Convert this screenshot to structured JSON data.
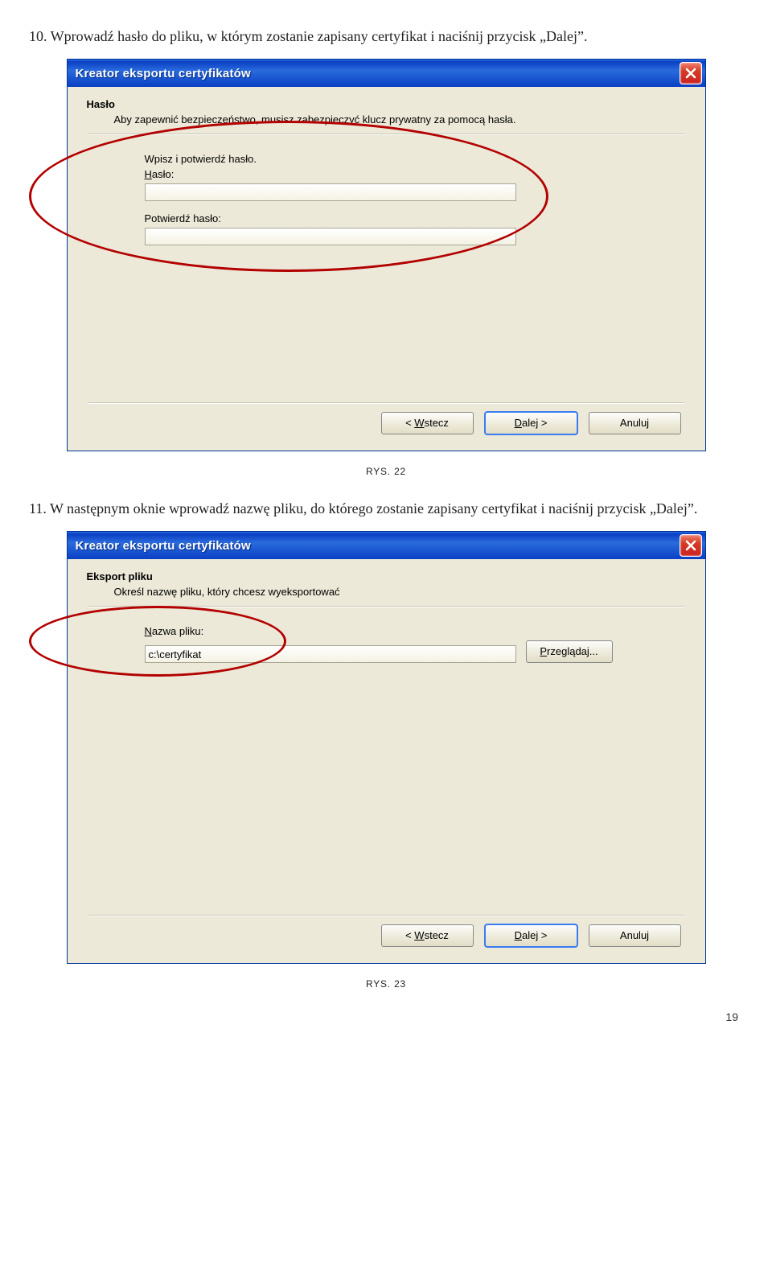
{
  "step10": {
    "text": "10. Wprowadź hasło do pliku, w którym zostanie zapisany certyfikat i naciśnij przycisk „Dalej”."
  },
  "dialog1": {
    "title": "Kreator eksportu certyfikatów",
    "heading": "Hasło",
    "desc": "Aby zapewnić bezpieczeństwo, musisz zabezpieczyć klucz prywatny za pomocą hasła.",
    "intro": "Wpisz i potwierdź hasło.",
    "password_label_pre": "H",
    "password_label_post": "asło:",
    "confirm_label": "Potwierdź hasło:",
    "back": "< Wstecz",
    "next": "Dalej >",
    "cancel": "Anuluj"
  },
  "caption1": "RYS. 22",
  "step11": {
    "text": "11. W następnym oknie wprowadź nazwę pliku, do którego zostanie zapisany certyfikat i naciśnij przycisk „Dalej”."
  },
  "dialog2": {
    "title": "Kreator eksportu certyfikatów",
    "heading": "Eksport pliku",
    "desc": "Określ nazwę pliku, który chcesz wyeksportować",
    "filename_label_pre": "N",
    "filename_label_post": "azwa pliku:",
    "filename_value": "c:\\certyfikat",
    "browse_pre": "P",
    "browse_post": "rzeglądaj...",
    "back": "< Wstecz",
    "next": "Dalej >",
    "cancel": "Anuluj"
  },
  "caption2": "RYS. 23",
  "page_number": "19",
  "back_underline": "W",
  "next_underline": "D",
  "browse_underline": "P"
}
